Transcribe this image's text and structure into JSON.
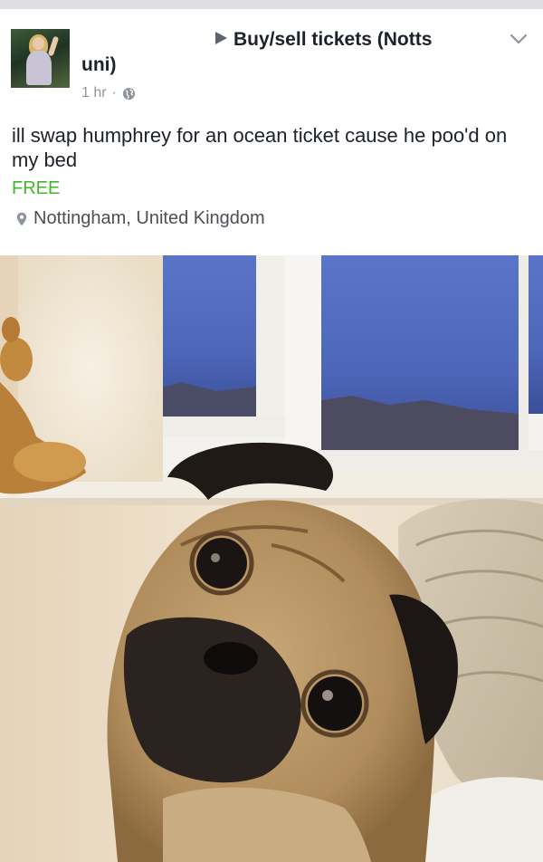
{
  "post": {
    "group_prefix": "Buy/sell tickets (Notts",
    "group_suffix": "uni)",
    "time": "1 hr",
    "separator": "·",
    "text": "ill swap humphrey for an ocean ticket cause he poo'd on my bed",
    "price": "FREE",
    "location": "Nottingham, United Kingdom"
  },
  "icons": {
    "dropdown": "chevron-down-icon",
    "privacy": "globe-icon",
    "location": "location-pin-icon",
    "group_arrow": "play-arrow-icon"
  },
  "colors": {
    "price": "#42b72a",
    "meta": "#90949c",
    "text": "#1d2129"
  }
}
